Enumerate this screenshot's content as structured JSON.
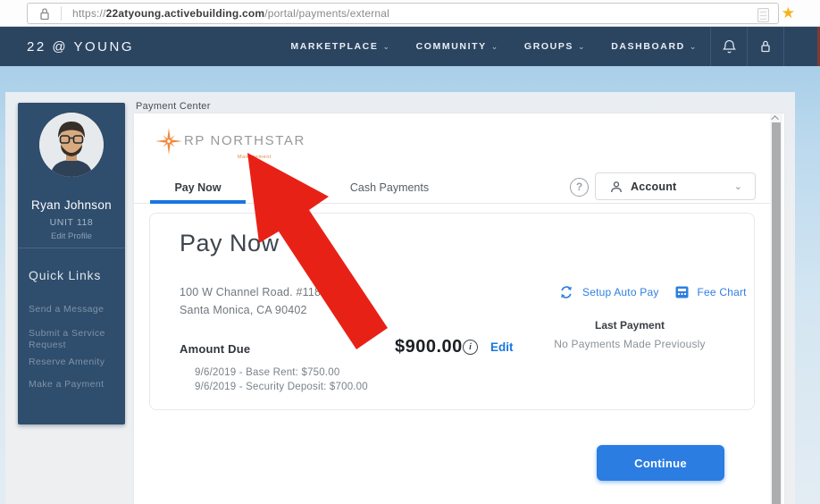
{
  "browser": {
    "url_scheme": "https://",
    "url_domain": "22atyoung.activebuilding.com",
    "url_path": "/portal/payments/external"
  },
  "icons": {
    "bookmark_star": "★",
    "chevron_down": "⌄",
    "question_mark": "?",
    "info_glyph": "i"
  },
  "navbar": {
    "brand": "22 @ YOUNG",
    "items": [
      {
        "label": "MARKETPLACE"
      },
      {
        "label": "COMMUNITY"
      },
      {
        "label": "GROUPS"
      },
      {
        "label": "DASHBOARD"
      }
    ]
  },
  "sidebar": {
    "profile": {
      "name": "Ryan Johnson",
      "unit": "UNIT 118",
      "edit": "Edit Profile"
    },
    "quick_links": {
      "title": "Quick Links",
      "items": [
        {
          "label": "Send a Message"
        },
        {
          "label": "Submit a Service Request"
        },
        {
          "label": "Reserve Amenity"
        },
        {
          "label": "Make a Payment"
        }
      ]
    }
  },
  "main": {
    "section_label": "Payment Center",
    "logo": {
      "title": "RP NORTHSTAR",
      "subtitle": "Management"
    },
    "tabs": [
      {
        "label": "Pay Now",
        "active": true
      },
      {
        "label": "Cash Payments",
        "active": false
      }
    ],
    "account": {
      "label": "Account"
    },
    "card": {
      "heading": "Pay Now",
      "address_line1": "100 W Channel Road. #118",
      "address_line2": "Santa Monica, CA 90402",
      "setup_auto_pay_label": "Setup Auto Pay",
      "fee_chart_label": "Fee Chart",
      "last_payment_label": "Last Payment",
      "last_payment_value": "No Payments Made Previously",
      "amount_due_label": "Amount Due",
      "amount_due_value": "$900.00",
      "edit_label": "Edit",
      "line_items": [
        "9/6/2019 - Base Rent: $750.00",
        "9/6/2019 - Security Deposit: $700.00"
      ]
    },
    "continue_label": "Continue"
  },
  "colors": {
    "navbar": "#2b4561",
    "sidebar": "#2f4d6c",
    "accent_blue": "#1877e0",
    "button_blue": "#2b7de2",
    "logo_orange": "#f08a3c",
    "arrow_red": "#e82117",
    "star_yellow": "#f4b41a"
  }
}
